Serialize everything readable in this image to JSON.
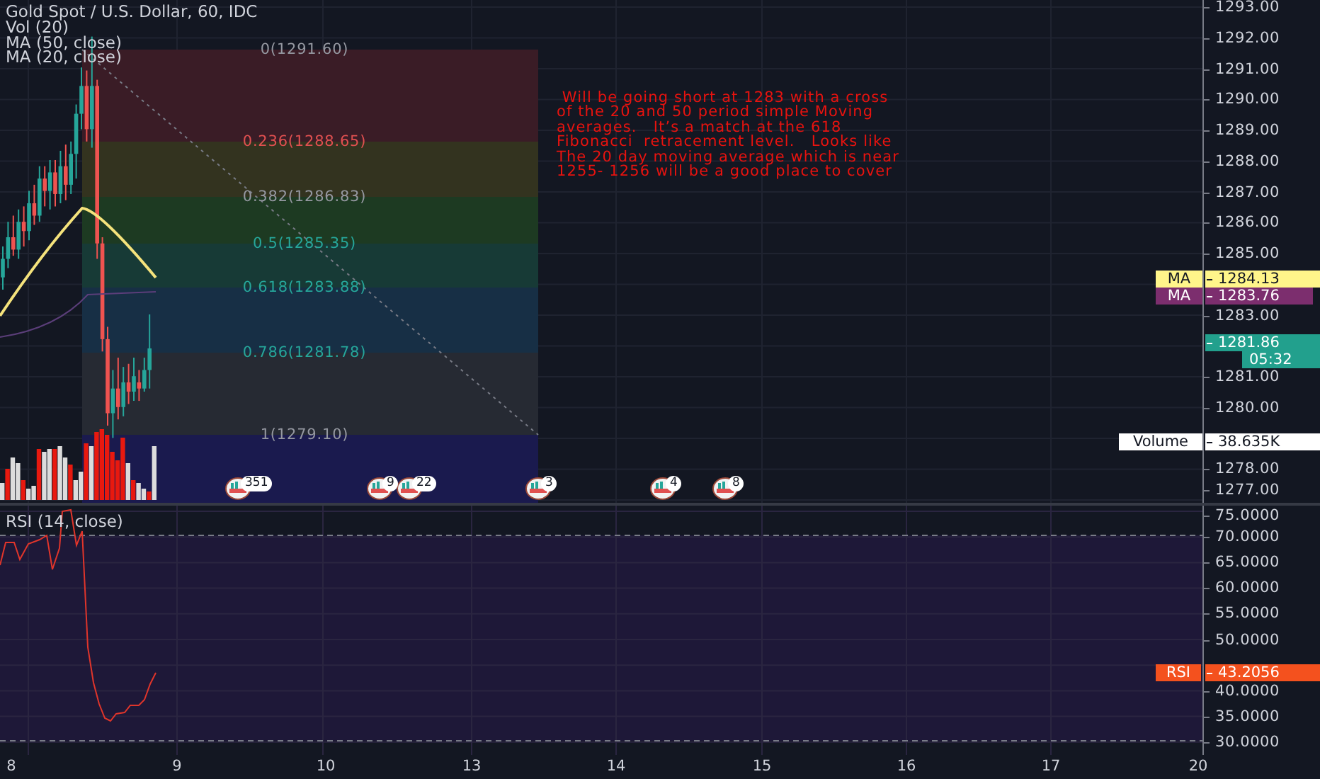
{
  "chart_title": "Gold Spot / U.S. Dollar, 60, IDC",
  "indicators": [
    "Vol (20)",
    "MA (50, close)",
    "MA (20, close)"
  ],
  "fib_levels": [
    {
      "label": "0(1291.60)",
      "color": "#3a1c26"
    },
    {
      "label": "0.236(1288.65)",
      "color": "#33331f"
    },
    {
      "label": "0.382(1286.83)",
      "color": "#1d3a22"
    },
    {
      "label": "0.5(1285.35)",
      "color": "#173a36"
    },
    {
      "label": "0.618(1283.88)",
      "color": "#172f45"
    },
    {
      "label": "0.786(1281.78)",
      "color": "#262a33"
    },
    {
      "label": "1(1279.10)",
      "color": "#1a1a4e"
    }
  ],
  "note": " Will be going short at 1283 with a cross\nof the 20 and 50 period simple Moving\naverages.   It’s a match at the 618\nFibonacci  retracement level.   Looks like\nThe 20 day moving average which is near\n1255- 1256 will be a good place to cover",
  "events": [
    {
      "count": "351"
    },
    {
      "count": "9"
    },
    {
      "count": "22"
    },
    {
      "count": "3"
    },
    {
      "count": "4"
    },
    {
      "count": "8"
    }
  ],
  "price_ticks": [
    "1293.00",
    "1292.00",
    "1291.00",
    "1290.00",
    "1289.00",
    "1288.00",
    "1287.00",
    "1286.00",
    "1285.00",
    "1283.00",
    "1281.00",
    "1280.00",
    "1278.00",
    "1277.00"
  ],
  "price_tags": [
    {
      "kind": "labeled",
      "label": "MA",
      "value": "1284.13",
      "color": "#fff58a"
    },
    {
      "kind": "labeled",
      "label": "MA",
      "value": "1283.76",
      "color": "#7c2e6e"
    },
    {
      "kind": "price",
      "value": "1281.86",
      "color": "#22a08d"
    },
    {
      "kind": "timer",
      "value": "05:32",
      "color": "#22a08d"
    },
    {
      "kind": "labeled",
      "label": "Volume",
      "value": "38.635K",
      "color": "#ffffff"
    }
  ],
  "rsi": {
    "title": "RSI (14, close)",
    "ticks": [
      "75.0000",
      "70.0000",
      "65.0000",
      "60.0000",
      "55.0000",
      "50.0000",
      "40.0000",
      "35.0000",
      "30.0000"
    ],
    "tag": {
      "label": "RSI",
      "value": "43.2056"
    }
  },
  "time_axis": [
    "8",
    "9",
    "10",
    "13",
    "14",
    "15",
    "16",
    "17",
    "20"
  ]
}
